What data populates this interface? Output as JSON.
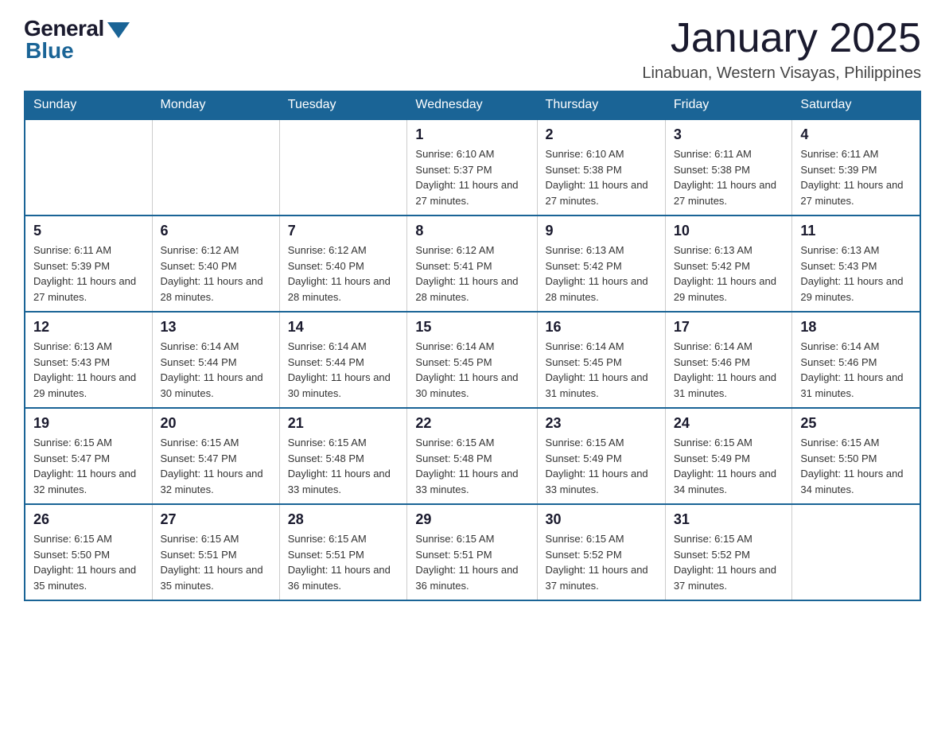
{
  "header": {
    "logo_general": "General",
    "logo_blue": "Blue",
    "month_title": "January 2025",
    "location": "Linabuan, Western Visayas, Philippines"
  },
  "days_of_week": [
    "Sunday",
    "Monday",
    "Tuesday",
    "Wednesday",
    "Thursday",
    "Friday",
    "Saturday"
  ],
  "weeks": [
    [
      {
        "day": "",
        "info": ""
      },
      {
        "day": "",
        "info": ""
      },
      {
        "day": "",
        "info": ""
      },
      {
        "day": "1",
        "info": "Sunrise: 6:10 AM\nSunset: 5:37 PM\nDaylight: 11 hours and 27 minutes."
      },
      {
        "day": "2",
        "info": "Sunrise: 6:10 AM\nSunset: 5:38 PM\nDaylight: 11 hours and 27 minutes."
      },
      {
        "day": "3",
        "info": "Sunrise: 6:11 AM\nSunset: 5:38 PM\nDaylight: 11 hours and 27 minutes."
      },
      {
        "day": "4",
        "info": "Sunrise: 6:11 AM\nSunset: 5:39 PM\nDaylight: 11 hours and 27 minutes."
      }
    ],
    [
      {
        "day": "5",
        "info": "Sunrise: 6:11 AM\nSunset: 5:39 PM\nDaylight: 11 hours and 27 minutes."
      },
      {
        "day": "6",
        "info": "Sunrise: 6:12 AM\nSunset: 5:40 PM\nDaylight: 11 hours and 28 minutes."
      },
      {
        "day": "7",
        "info": "Sunrise: 6:12 AM\nSunset: 5:40 PM\nDaylight: 11 hours and 28 minutes."
      },
      {
        "day": "8",
        "info": "Sunrise: 6:12 AM\nSunset: 5:41 PM\nDaylight: 11 hours and 28 minutes."
      },
      {
        "day": "9",
        "info": "Sunrise: 6:13 AM\nSunset: 5:42 PM\nDaylight: 11 hours and 28 minutes."
      },
      {
        "day": "10",
        "info": "Sunrise: 6:13 AM\nSunset: 5:42 PM\nDaylight: 11 hours and 29 minutes."
      },
      {
        "day": "11",
        "info": "Sunrise: 6:13 AM\nSunset: 5:43 PM\nDaylight: 11 hours and 29 minutes."
      }
    ],
    [
      {
        "day": "12",
        "info": "Sunrise: 6:13 AM\nSunset: 5:43 PM\nDaylight: 11 hours and 29 minutes."
      },
      {
        "day": "13",
        "info": "Sunrise: 6:14 AM\nSunset: 5:44 PM\nDaylight: 11 hours and 30 minutes."
      },
      {
        "day": "14",
        "info": "Sunrise: 6:14 AM\nSunset: 5:44 PM\nDaylight: 11 hours and 30 minutes."
      },
      {
        "day": "15",
        "info": "Sunrise: 6:14 AM\nSunset: 5:45 PM\nDaylight: 11 hours and 30 minutes."
      },
      {
        "day": "16",
        "info": "Sunrise: 6:14 AM\nSunset: 5:45 PM\nDaylight: 11 hours and 31 minutes."
      },
      {
        "day": "17",
        "info": "Sunrise: 6:14 AM\nSunset: 5:46 PM\nDaylight: 11 hours and 31 minutes."
      },
      {
        "day": "18",
        "info": "Sunrise: 6:14 AM\nSunset: 5:46 PM\nDaylight: 11 hours and 31 minutes."
      }
    ],
    [
      {
        "day": "19",
        "info": "Sunrise: 6:15 AM\nSunset: 5:47 PM\nDaylight: 11 hours and 32 minutes."
      },
      {
        "day": "20",
        "info": "Sunrise: 6:15 AM\nSunset: 5:47 PM\nDaylight: 11 hours and 32 minutes."
      },
      {
        "day": "21",
        "info": "Sunrise: 6:15 AM\nSunset: 5:48 PM\nDaylight: 11 hours and 33 minutes."
      },
      {
        "day": "22",
        "info": "Sunrise: 6:15 AM\nSunset: 5:48 PM\nDaylight: 11 hours and 33 minutes."
      },
      {
        "day": "23",
        "info": "Sunrise: 6:15 AM\nSunset: 5:49 PM\nDaylight: 11 hours and 33 minutes."
      },
      {
        "day": "24",
        "info": "Sunrise: 6:15 AM\nSunset: 5:49 PM\nDaylight: 11 hours and 34 minutes."
      },
      {
        "day": "25",
        "info": "Sunrise: 6:15 AM\nSunset: 5:50 PM\nDaylight: 11 hours and 34 minutes."
      }
    ],
    [
      {
        "day": "26",
        "info": "Sunrise: 6:15 AM\nSunset: 5:50 PM\nDaylight: 11 hours and 35 minutes."
      },
      {
        "day": "27",
        "info": "Sunrise: 6:15 AM\nSunset: 5:51 PM\nDaylight: 11 hours and 35 minutes."
      },
      {
        "day": "28",
        "info": "Sunrise: 6:15 AM\nSunset: 5:51 PM\nDaylight: 11 hours and 36 minutes."
      },
      {
        "day": "29",
        "info": "Sunrise: 6:15 AM\nSunset: 5:51 PM\nDaylight: 11 hours and 36 minutes."
      },
      {
        "day": "30",
        "info": "Sunrise: 6:15 AM\nSunset: 5:52 PM\nDaylight: 11 hours and 37 minutes."
      },
      {
        "day": "31",
        "info": "Sunrise: 6:15 AM\nSunset: 5:52 PM\nDaylight: 11 hours and 37 minutes."
      },
      {
        "day": "",
        "info": ""
      }
    ]
  ]
}
